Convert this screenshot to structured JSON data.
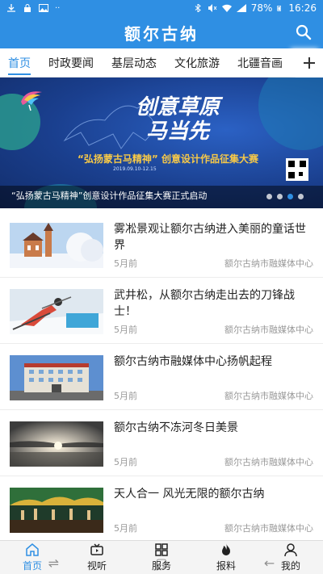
{
  "status_bar": {
    "battery": "78%",
    "time": "16:26",
    "left_icons": [
      "download-icon",
      "lock-icon",
      "image-icon",
      "more-dots-icon"
    ],
    "right_icons": [
      "bluetooth-icon",
      "mute-icon",
      "wifi-icon",
      "signal-icon",
      "battery-icon"
    ]
  },
  "header": {
    "title": "额尔古纳",
    "background": "#2f8fe3",
    "search_icon": "search-icon"
  },
  "tabs": {
    "items": [
      {
        "label": "首页",
        "active": true
      },
      {
        "label": "时政要闻",
        "active": false
      },
      {
        "label": "基层动态",
        "active": false
      },
      {
        "label": "文化旅游",
        "active": false
      },
      {
        "label": "北疆音画",
        "active": false
      }
    ],
    "more_icon": "plus-icon"
  },
  "banner": {
    "headline_line1": "创意草原",
    "headline_line2": "马当先",
    "subtitle": "“弘扬蒙古马精神” 创意设计作品征集大赛",
    "date": "2019.09.10-12.15",
    "caption": "“弘扬蒙古马精神”创意设计作品征集大赛正式启动",
    "slide_count": 4,
    "active_slide": 3
  },
  "news": [
    {
      "title": "雾凇景观让额尔古纳进入美丽的童话世界",
      "time": "5月前",
      "source": "额尔古纳市融媒体中心",
      "thumb": "frosted-trees-church"
    },
    {
      "title": "武井松，从额尔古纳走出去的刀锋战士！",
      "time": "5月前",
      "source": "额尔古纳市融媒体中心",
      "thumb": "skier"
    },
    {
      "title": "额尔古纳市融媒体中心扬帆起程",
      "time": "5月前",
      "source": "额尔古纳市融媒体中心",
      "thumb": "building"
    },
    {
      "title": "额尔古纳不冻河冬日美景",
      "time": "5月前",
      "source": "额尔古纳市融媒体中心",
      "thumb": "misty-river"
    },
    {
      "title": "天人合一 风光无限的额尔古纳",
      "time": "5月前",
      "source": "额尔古纳市融媒体中心",
      "thumb": "stage-performance"
    }
  ],
  "tabbar": [
    {
      "label": "首页",
      "icon": "home-icon",
      "active": true
    },
    {
      "label": "视听",
      "icon": "tv-icon",
      "active": false
    },
    {
      "label": "服务",
      "icon": "grid-icon",
      "active": false
    },
    {
      "label": "报料",
      "icon": "flame-icon",
      "active": false
    },
    {
      "label": "我的",
      "icon": "user-icon",
      "active": false
    }
  ],
  "colors": {
    "accent": "#2f8fe3",
    "text_primary": "#222222",
    "text_secondary": "#999999"
  }
}
